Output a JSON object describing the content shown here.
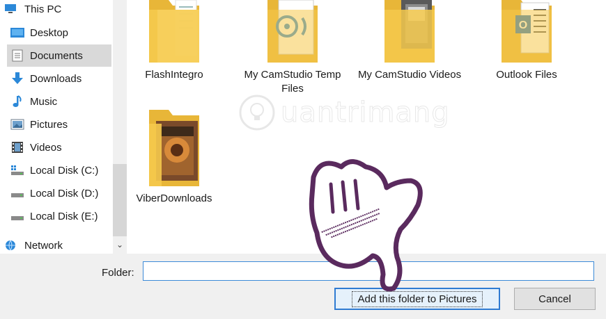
{
  "sidebar": {
    "items": [
      {
        "label": "This PC",
        "icon": "monitor-icon"
      },
      {
        "label": "Desktop",
        "icon": "desktop-icon"
      },
      {
        "label": "Documents",
        "icon": "documents-icon",
        "selected": true
      },
      {
        "label": "Downloads",
        "icon": "download-arrow-icon"
      },
      {
        "label": "Music",
        "icon": "music-note-icon"
      },
      {
        "label": "Pictures",
        "icon": "pictures-icon"
      },
      {
        "label": "Videos",
        "icon": "film-icon"
      },
      {
        "label": "Local Disk (C:)",
        "icon": "system-drive-icon"
      },
      {
        "label": "Local Disk (D:)",
        "icon": "drive-icon"
      },
      {
        "label": "Local Disk (E:)",
        "icon": "drive-icon"
      },
      {
        "label": "Network",
        "icon": "network-icon"
      }
    ]
  },
  "folders": [
    {
      "name": "FlashIntegro",
      "icon": "folder-icon"
    },
    {
      "name": "My CamStudio Temp Files",
      "icon": "folder-camstudio-icon"
    },
    {
      "name": "My CamStudio Videos",
      "icon": "folder-video-icon"
    },
    {
      "name": "Outlook Files",
      "icon": "folder-outlook-icon"
    },
    {
      "name": "ViberDownloads",
      "icon": "folder-image-icon"
    }
  ],
  "watermark": {
    "text": "uantrimang",
    "glyph": "Q"
  },
  "bottom": {
    "folder_label": "Folder:",
    "folder_value": "",
    "add_button": "Add this folder to Pictures",
    "cancel_button": "Cancel"
  },
  "colors": {
    "accent": "#2f7bd2",
    "folder_yellow": "#f5c94c",
    "hand_outline": "#5a2a5e"
  }
}
